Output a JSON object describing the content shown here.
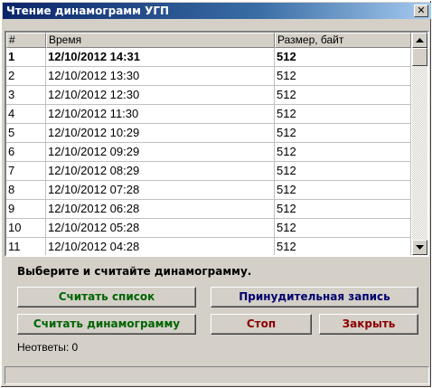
{
  "window": {
    "title": "Чтение динамограмм УГП",
    "close_glyph": "✕"
  },
  "table": {
    "headers": {
      "num": "#",
      "time": "Время",
      "size": "Размер, байт"
    },
    "rows": [
      {
        "num": "1",
        "time": "12/10/2012 14:31",
        "size": "512",
        "selected": true
      },
      {
        "num": "2",
        "time": "12/10/2012 13:30",
        "size": "512"
      },
      {
        "num": "3",
        "time": "12/10/2012 12:30",
        "size": "512"
      },
      {
        "num": "4",
        "time": "12/10/2012 11:30",
        "size": "512"
      },
      {
        "num": "5",
        "time": "12/10/2012 10:29",
        "size": "512"
      },
      {
        "num": "6",
        "time": "12/10/2012 09:29",
        "size": "512"
      },
      {
        "num": "7",
        "time": "12/10/2012 08:29",
        "size": "512"
      },
      {
        "num": "8",
        "time": "12/10/2012 07:28",
        "size": "512"
      },
      {
        "num": "9",
        "time": "12/10/2012 06:28",
        "size": "512"
      },
      {
        "num": "10",
        "time": "12/10/2012 05:28",
        "size": "512"
      },
      {
        "num": "11",
        "time": "12/10/2012 04:28",
        "size": "512"
      }
    ]
  },
  "panel": {
    "prompt": "Выберите и считайте динамограмму.",
    "read_list": "Считать список",
    "force_write": "Принудительная запись",
    "read_dynamogram": "Считать динамограмму",
    "stop": "Стоп",
    "close": "Закрыть",
    "no_responses": "Неответы: 0"
  }
}
